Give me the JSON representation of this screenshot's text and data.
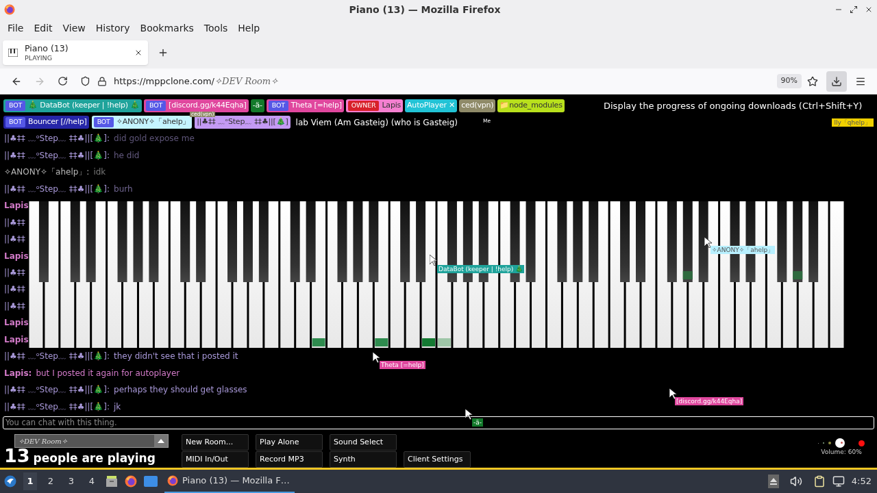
{
  "window": {
    "title": "Piano (13) — Mozilla Firefox"
  },
  "menu": [
    "File",
    "Edit",
    "View",
    "History",
    "Bookmarks",
    "Tools",
    "Help"
  ],
  "tabs": [
    {
      "title": "Piano (13)",
      "status": "PLAYING",
      "selected": true
    }
  ],
  "address": {
    "host": "https://mppclone.com/",
    "path": "✧DEV Room✧",
    "zoom": "90%",
    "downloads_active": true
  },
  "tooltip": "Display the progress of ongoing downloads (Ctrl+Shift+Y)",
  "users_row_1": [
    {
      "kind": "bot",
      "badge": "BOT",
      "name": "🎄 DataBot (keeper | !help) 🎄",
      "color": "#1fa39b"
    },
    {
      "kind": "bot",
      "badge": "BOT",
      "name": "[discord.gg/k44Eqha]",
      "color": "#e0479e"
    },
    {
      "kind": "plain",
      "name": "-ä-",
      "color": "#13792b"
    },
    {
      "kind": "bot",
      "badge": "BOT",
      "name": "Theta [=help]",
      "color": "#e0479e"
    },
    {
      "kind": "owner",
      "badge": "OWNER",
      "name": "Lapis",
      "color": "#f47fd0"
    },
    {
      "kind": "plain",
      "name": "AutoPlayer ✕",
      "color": "#22c3d6"
    },
    {
      "kind": "plain",
      "name": "ced(vpn)",
      "color": "#8f8a68"
    },
    {
      "kind": "plain",
      "name": "📁node_modules",
      "color": "#b8e01c"
    }
  ],
  "users_row_2": [
    {
      "kind": "bot",
      "badge": "BOT",
      "name": "Bouncer [//help]",
      "color": "#2626a8"
    },
    {
      "kind": "bot",
      "badge": "BOT",
      "name": "✧ANONY✧「ahelp」",
      "color": "#c4f4ff"
    },
    {
      "kind": "plain",
      "name": "||♣‡‡ ﹏ᵒStep﹏ ‡‡♣||[🎄]",
      "color": "#c49af4"
    },
    {
      "kind": "text",
      "name": "lab Viem (Am Gasteig) (who is Gasteig)"
    }
  ],
  "corner_tag": {
    "name": "lly「qhelp」",
    "color": "#f0d000"
  },
  "chat": [
    {
      "name": "||♣‡‡ ﹏ᵒStep﹏ ‡‡♣||[🎄]:",
      "text": "did gold expose me",
      "color": "#a898d8"
    },
    {
      "name": "||♣‡‡ ﹏ᵒStep﹏ ‡‡♣||[🎄]:",
      "text": "he did",
      "color": "#a898d8"
    },
    {
      "name": "✧ANONY✧「ahelp」:",
      "text": "idk",
      "color": "#b8b8b8"
    },
    {
      "name": "||♣‡‡ ﹏ᵒStep﹏ ‡‡♣||[🎄]:",
      "text": "burh",
      "color": "#a898d8"
    },
    {
      "name": "Lapis",
      "color": "#d27ac8"
    },
    {
      "name": "||♣‡‡",
      "color": "#a898d8"
    },
    {
      "name": "||♣‡‡",
      "color": "#a898d8"
    },
    {
      "name": "Lapis",
      "color": "#d27ac8"
    },
    {
      "name": "||♣‡‡",
      "color": "#a898d8"
    },
    {
      "name": "||♣‡‡",
      "color": "#a898d8"
    },
    {
      "name": "||♣‡‡",
      "color": "#a898d8"
    },
    {
      "name": "Lapis",
      "color": "#d27ac8"
    },
    {
      "name": "Lapis",
      "color": "#d27ac8"
    },
    {
      "name": "||♣‡‡ ﹏ᵒStep﹏ ‡‡♣||[🎄]:",
      "text": "they didn't see that i posted it",
      "color": "#a898d8"
    },
    {
      "name": "Lapis:",
      "text": "but I posted it again for autoplayer",
      "color": "#d27ac8"
    },
    {
      "name": "||♣‡‡ ﹏ᵒStep﹏ ‡‡♣||[🎄]:",
      "text": "perhaps they should get glasses",
      "color": "#a898d8"
    },
    {
      "name": "||♣‡‡ ﹏ᵒStep﹏ ‡‡♣||[🎄]:",
      "text": "jk",
      "color": "#a898d8"
    }
  ],
  "cursors": [
    {
      "name": "ced(vpn)",
      "color": "#8f8a68"
    },
    {
      "name": "Me"
    },
    {
      "name": "DataBot (keeper | !help) 🎄",
      "color": "#1fa39b"
    },
    {
      "name": "✧ANONY✧「ahelp」",
      "color": "#b8f0ff"
    },
    {
      "name": "Theta [=help]",
      "color": "#e0479e"
    },
    {
      "name": "[discord.gg/k44Eqha]",
      "color": "#e0479e"
    },
    {
      "name": "-ä-",
      "color": "#13792b"
    }
  ],
  "chat_input": {
    "placeholder": "You can chat with this thing."
  },
  "room_select": {
    "value": "✧DEV Room✧"
  },
  "player_count": {
    "number": "13",
    "label": "people are playing"
  },
  "buttons": [
    [
      "New Room...",
      "Play Alone",
      "Sound Select"
    ],
    [
      "MIDI In/Out",
      "Record MP3",
      "Synth",
      "Client Settings"
    ]
  ],
  "volume": {
    "level": 0.6,
    "reading": "Volume: 60%"
  },
  "taskbar": {
    "workspaces": [
      {
        "label": "1",
        "selected": true
      },
      {
        "label": "2",
        "selected": false
      },
      {
        "label": "3",
        "selected": false
      },
      {
        "label": "4",
        "selected": false
      }
    ],
    "task": "Piano (13) — Mozilla F…",
    "clock": "4:52"
  }
}
